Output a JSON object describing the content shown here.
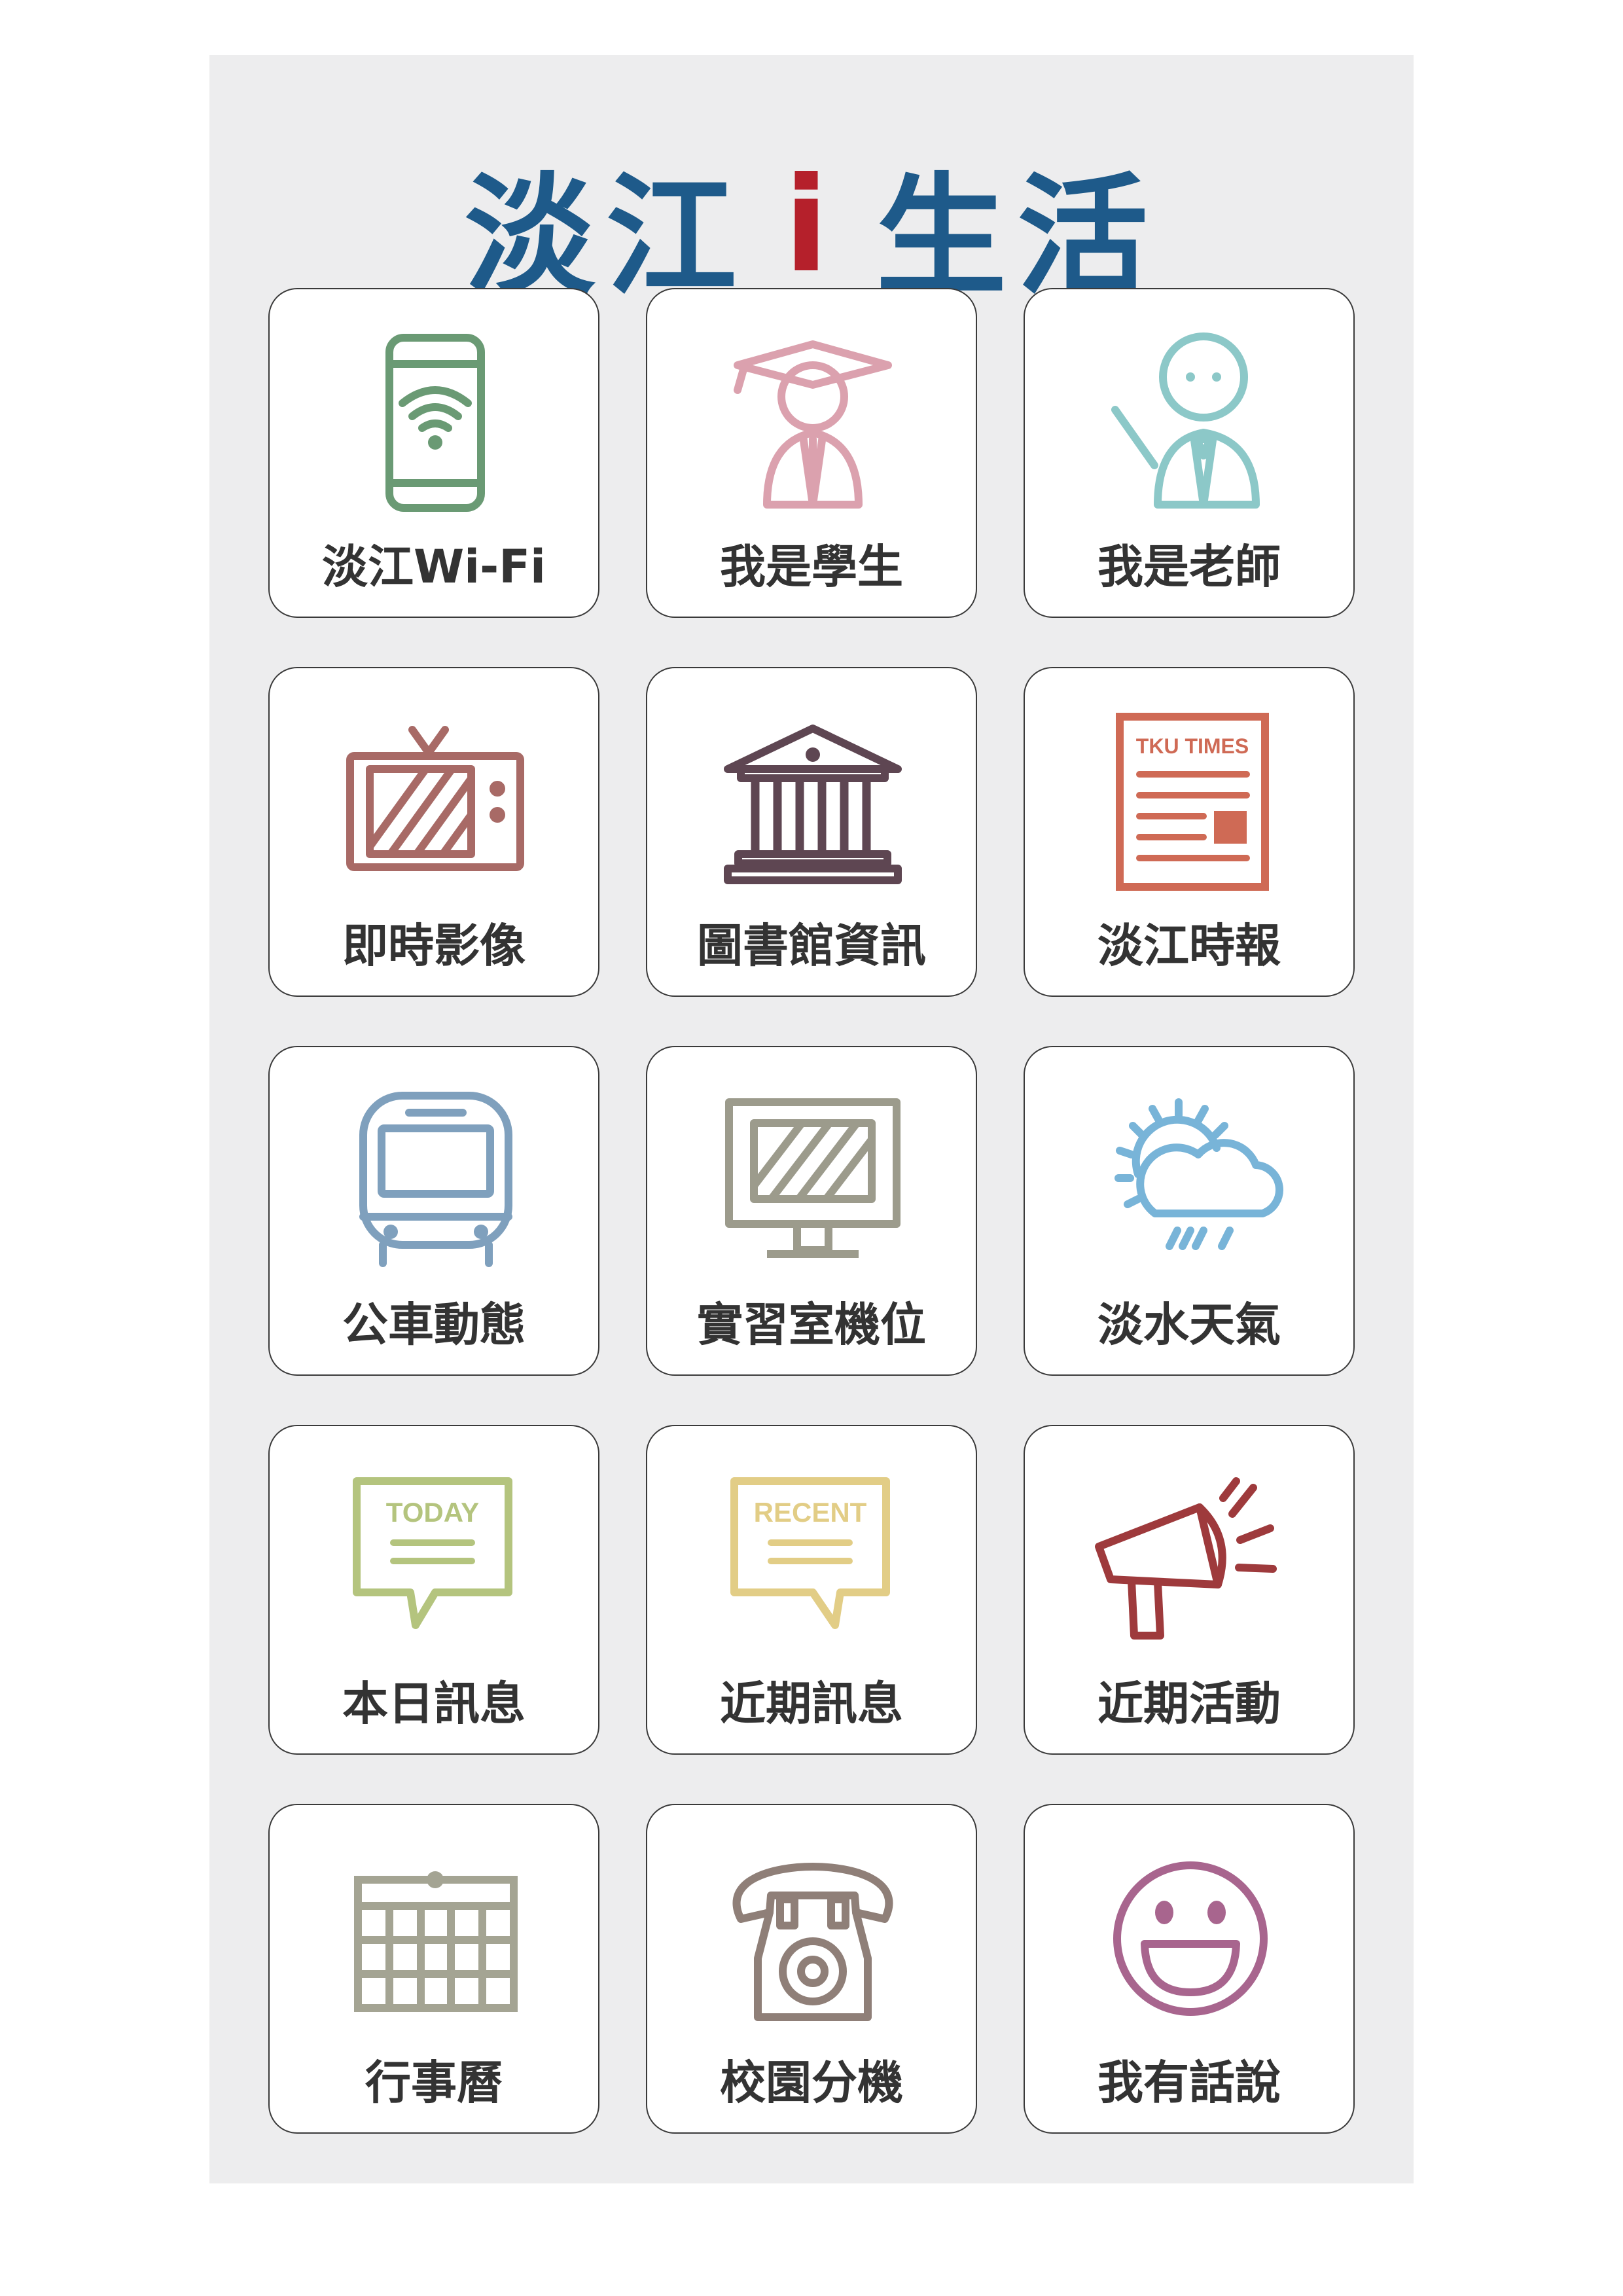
{
  "header": {
    "title_left": "淡江",
    "title_mid": "i",
    "title_right": "生活",
    "colors": {
      "blue": "#1e5a8a",
      "red": "#b5202b"
    }
  },
  "tiles": [
    {
      "label": "淡江Wi-Fi",
      "icon": "wifi-phone-icon",
      "color": "#6a9a74"
    },
    {
      "label": "我是學生",
      "icon": "graduate-student-icon",
      "color": "#dba1ae"
    },
    {
      "label": "我是老師",
      "icon": "teacher-icon",
      "color": "#8cc8c8"
    },
    {
      "label": "即時影像",
      "icon": "television-icon",
      "color": "#a86a66"
    },
    {
      "label": "圖書館資訊",
      "icon": "library-building-icon",
      "color": "#5e4652"
    },
    {
      "label": "淡江時報",
      "icon": "newspaper-icon",
      "color": "#cf6a55",
      "icon_text": "TKU TIMES"
    },
    {
      "label": "公車動態",
      "icon": "bus-icon",
      "color": "#7fa0bd"
    },
    {
      "label": "實習室機位",
      "icon": "computer-monitor-icon",
      "color": "#9c9b8c"
    },
    {
      "label": "淡水天氣",
      "icon": "weather-icon",
      "color": "#78b4d8"
    },
    {
      "label": "本日訊息",
      "icon": "today-message-icon",
      "color": "#b4c47e",
      "icon_text": "TODAY"
    },
    {
      "label": "近期訊息",
      "icon": "recent-message-icon",
      "color": "#e2cd86",
      "icon_text": "RECENT"
    },
    {
      "label": "近期活動",
      "icon": "megaphone-icon",
      "color": "#9e3a3c"
    },
    {
      "label": "行事曆",
      "icon": "calendar-icon",
      "color": "#a4a493"
    },
    {
      "label": "校園分機",
      "icon": "telephone-icon",
      "color": "#8f7f78"
    },
    {
      "label": "我有話說",
      "icon": "smiley-icon",
      "color": "#a8658e"
    }
  ]
}
